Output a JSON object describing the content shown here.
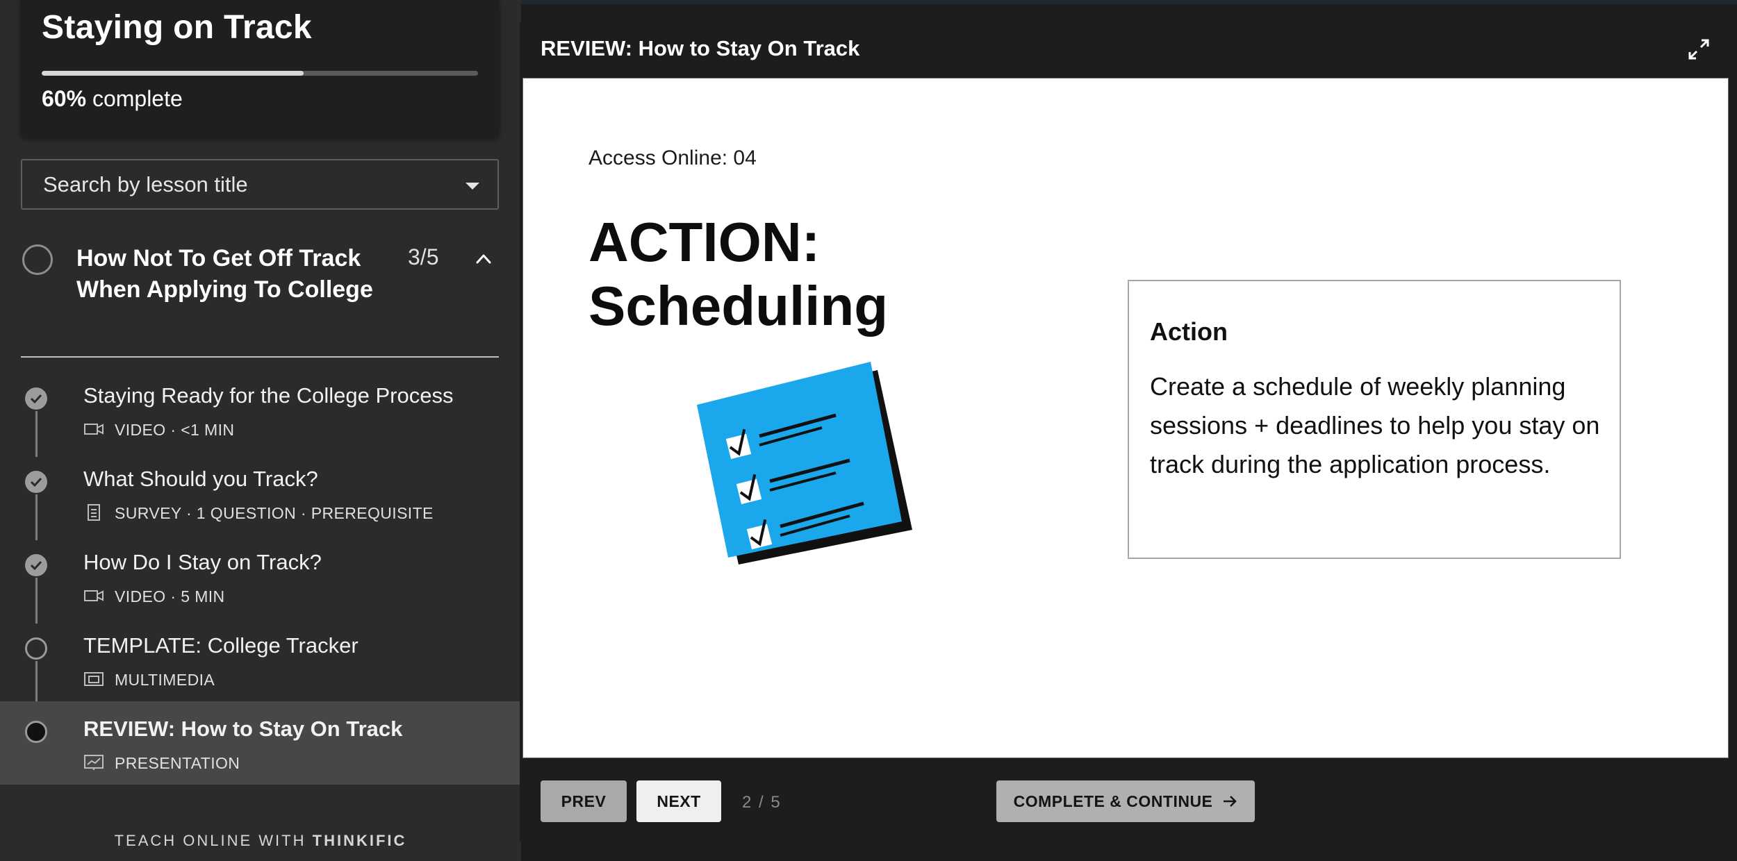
{
  "course": {
    "title": "Staying on Track",
    "progress_percent": "60%",
    "progress_label": "complete",
    "progress_value": 0.6
  },
  "search": {
    "placeholder": "Search by lesson title"
  },
  "chapter": {
    "title": "How Not To Get Off Track When Applying To College",
    "count": "3/5"
  },
  "lessons": [
    {
      "title": "Staying Ready for the College Process",
      "meta": "VIDEO · <1 MIN",
      "status": "complete",
      "icon": "video-icon"
    },
    {
      "title": "What Should you Track?",
      "meta": "SURVEY · 1 QUESTION · PREREQUISITE",
      "status": "complete",
      "icon": "survey-icon"
    },
    {
      "title": "How Do I Stay on Track?",
      "meta": "VIDEO · 5 MIN",
      "status": "complete",
      "icon": "video-icon"
    },
    {
      "title": "TEMPLATE: College Tracker",
      "meta": "MULTIMEDIA",
      "status": "incomplete",
      "icon": "multimedia-icon"
    },
    {
      "title": "REVIEW: How to Stay On Track",
      "meta": "PRESENTATION",
      "status": "current",
      "icon": "presentation-icon"
    }
  ],
  "footer": {
    "brand_prefix": "TEACH ONLINE WITH",
    "brand_name": "THINKIFIC"
  },
  "main": {
    "title": "REVIEW: How to Stay On Track",
    "slide": {
      "kicker": "Access Online: 04",
      "heading_line1": "ACTION:",
      "heading_line2": "Scheduling",
      "box_title": "Action",
      "box_body": "Create a schedule of weekly planning sessions + deadlines to help you stay on track during the application process."
    },
    "controls": {
      "prev_label": "PREV",
      "next_label": "NEXT",
      "page_indicator": "2 / 5",
      "complete_label": "COMPLETE & CONTINUE"
    }
  },
  "colors": {
    "sidebar_bg": "#2b2b2b",
    "active_lesson_bg": "#474747",
    "slide_accent": "#1aa7ec"
  }
}
